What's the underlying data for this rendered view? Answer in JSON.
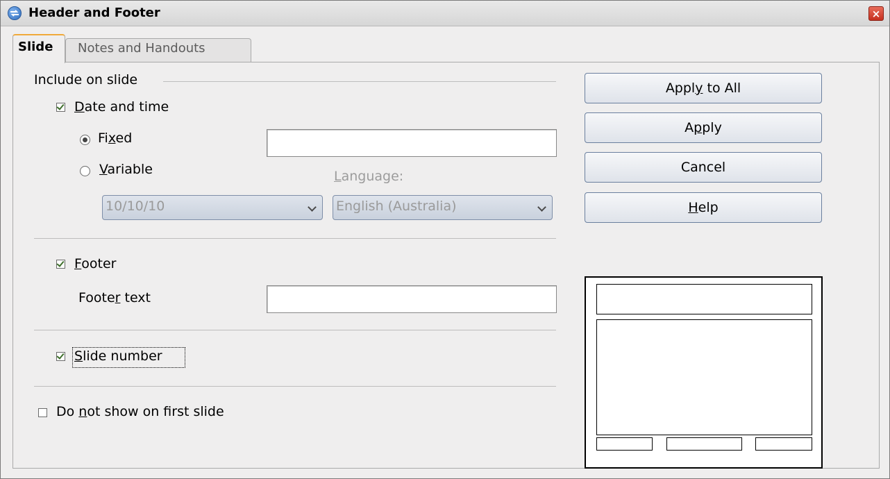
{
  "window": {
    "title": "Header and Footer",
    "close_label": "×"
  },
  "tabs": [
    {
      "label": "Slide",
      "active": true
    },
    {
      "label": "Notes and Handouts",
      "active": false
    }
  ],
  "section": {
    "include_label": "Include on slide"
  },
  "date_time": {
    "checked": true,
    "label_pre": "",
    "label_mn": "D",
    "label_post": "ate and time",
    "fixed": {
      "pre": "Fi",
      "mn": "x",
      "post": "ed",
      "selected": true,
      "value": ""
    },
    "variable": {
      "pre": "",
      "mn": "V",
      "post": "ariable",
      "selected": false
    },
    "format_value": "10/10/10",
    "language": {
      "label_pre": "",
      "label_mn": "L",
      "label_post": "anguage:",
      "value": "English (Australia)"
    }
  },
  "footer": {
    "checked": true,
    "label_pre": "",
    "label_mn": "F",
    "label_post": "ooter",
    "text_label_pre": "Foote",
    "text_label_mn": "r",
    "text_label_post": " text",
    "text_value": ""
  },
  "slide_number": {
    "checked": true,
    "label_pre": "",
    "label_mn": "S",
    "label_post": "lide number"
  },
  "first_slide": {
    "checked": false,
    "label_pre": "Do ",
    "label_mn": "n",
    "label_post": "ot show on first slide"
  },
  "buttons": {
    "apply_all": {
      "pre": "Appl",
      "mn": "y",
      "post": " to All"
    },
    "apply": {
      "pre": "A",
      "mn": "p",
      "post": "ply"
    },
    "cancel": {
      "pre": "Cancel",
      "mn": "",
      "post": ""
    },
    "help": {
      "pre": "",
      "mn": "H",
      "post": "elp"
    }
  },
  "colors": {
    "dialog_bg": "#efeeee",
    "tab_accent": "#f0a93a",
    "close_red": "#c6301f",
    "check_green": "#3d6e2a"
  }
}
